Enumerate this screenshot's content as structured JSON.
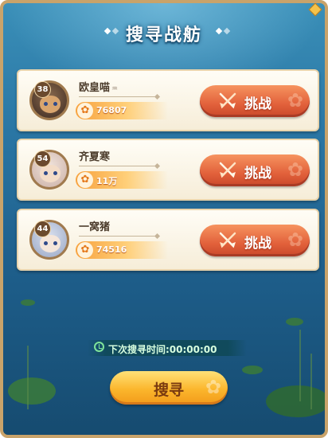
{
  "header": {
    "title": "搜寻战舫"
  },
  "opponents": [
    {
      "level": "38",
      "name": "欧皇喵",
      "name_deco": "♒",
      "power": "76807",
      "challenge_label": "挑战"
    },
    {
      "level": "54",
      "name": "齐夏寒",
      "name_deco": "",
      "power": "11万",
      "challenge_label": "挑战"
    },
    {
      "level": "44",
      "name": "一窝猪",
      "name_deco": "",
      "power": "74516",
      "challenge_label": "挑战"
    }
  ],
  "timer": {
    "text": "下次搜寻时间:00:00:00"
  },
  "search_button": {
    "label": "搜寻"
  },
  "colors": {
    "challenge_button": "#e2613b",
    "search_button": "#fbb62c",
    "power_bar": "#f7a23f",
    "timer_text": "#d8ffe0"
  }
}
